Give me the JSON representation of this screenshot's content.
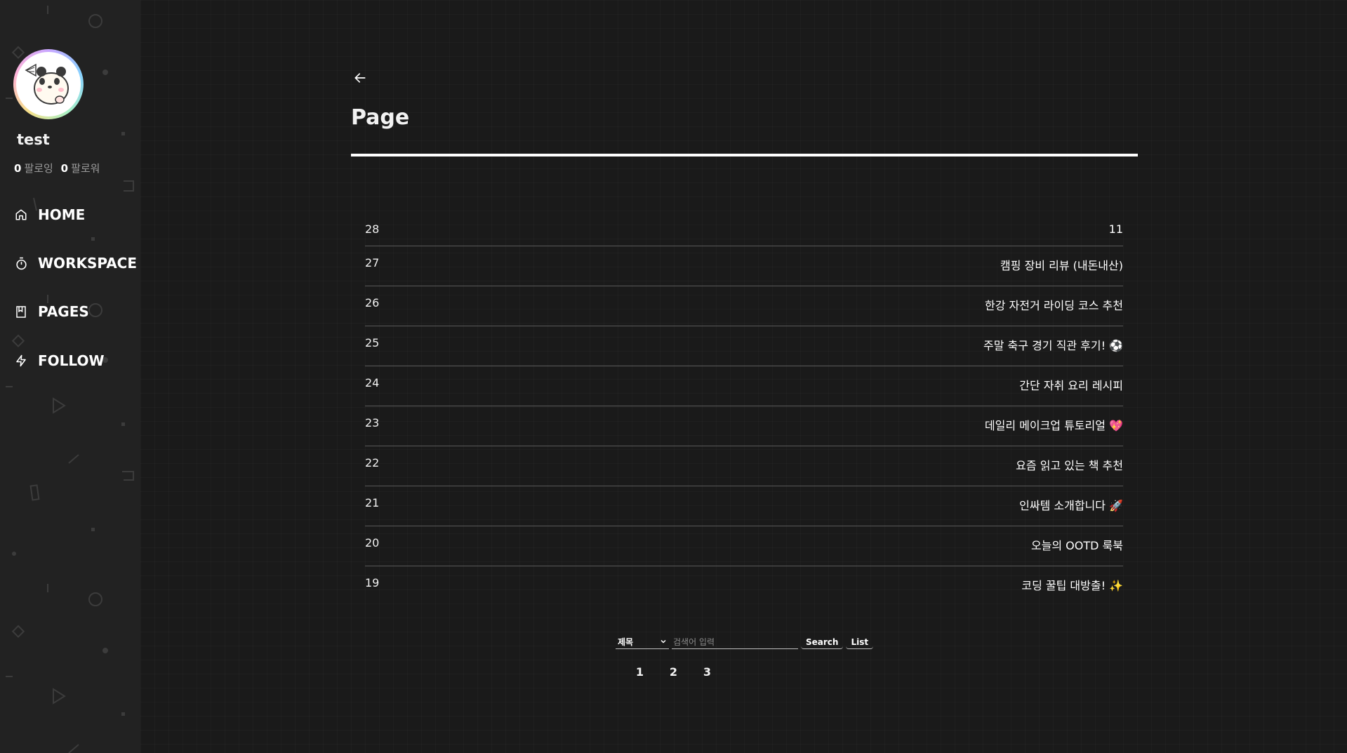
{
  "profile": {
    "username": "test",
    "following_count": "0",
    "following_label": "팔로잉",
    "follower_count": "0",
    "follower_label": "팔로워"
  },
  "nav": {
    "items": [
      {
        "label": "HOME",
        "icon": "home-icon"
      },
      {
        "label": "WORKSPACE",
        "icon": "timer-icon"
      },
      {
        "label": "PAGES",
        "icon": "book-icon"
      },
      {
        "label": "FOLLOW",
        "icon": "lightning-icon"
      }
    ]
  },
  "main": {
    "title": "Page",
    "posts": [
      {
        "num": "28",
        "title": "11"
      },
      {
        "num": "27",
        "title": "캠핑 장비 리뷰 (내돈내산)"
      },
      {
        "num": "26",
        "title": "한강 자전거 라이딩 코스 추천"
      },
      {
        "num": "25",
        "title": "주말 축구 경기 직관 후기! ⚽"
      },
      {
        "num": "24",
        "title": "간단 자취 요리 레시피"
      },
      {
        "num": "23",
        "title": "데일리 메이크업 튜토리얼 💖"
      },
      {
        "num": "22",
        "title": "요즘 읽고 있는 책 추천"
      },
      {
        "num": "21",
        "title": "인싸템 소개합니다 🚀"
      },
      {
        "num": "20",
        "title": "오늘의 OOTD 룩북"
      },
      {
        "num": "19",
        "title": "코딩 꿀팁 대방출! ✨"
      }
    ]
  },
  "search": {
    "select_value": "제목",
    "placeholder": "검색어 입력",
    "search_label": "Search",
    "list_label": "List"
  },
  "pagination": {
    "pages": [
      "1",
      "2",
      "3"
    ]
  }
}
